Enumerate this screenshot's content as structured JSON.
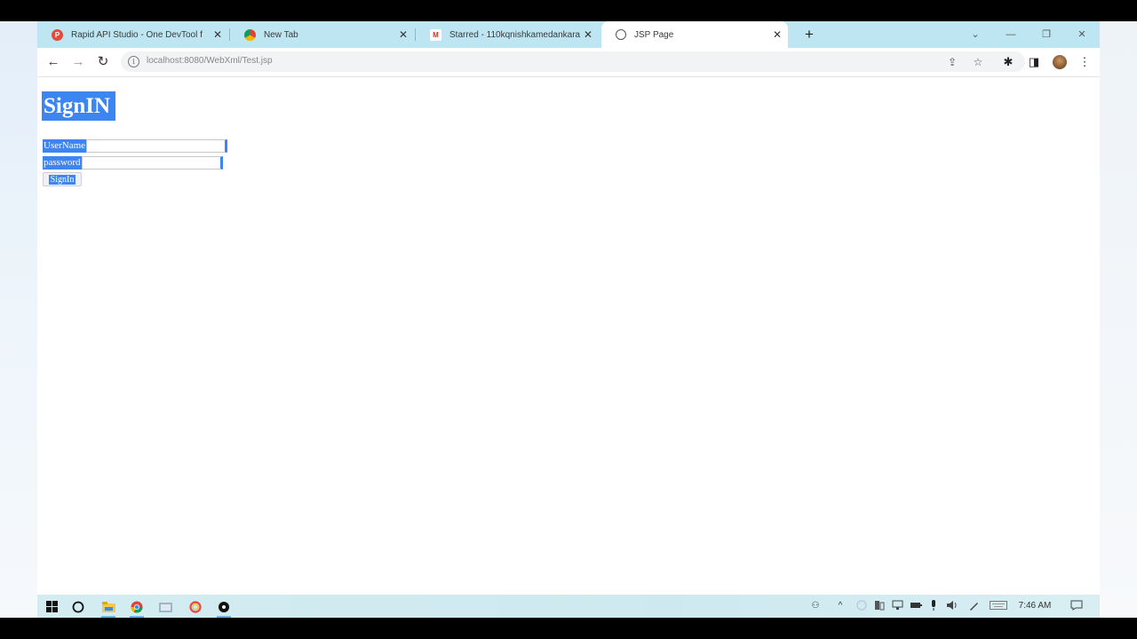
{
  "browser": {
    "tabs": [
      {
        "title": "Rapid API Studio - One DevTool f",
        "favicon": "rapidapi-icon",
        "favicon_letter": "P",
        "favicon_color": "#e14d3a",
        "active": false
      },
      {
        "title": "New Tab",
        "favicon": "chrome-icon",
        "active": false
      },
      {
        "title": "Starred - 110kqnishkamedankara",
        "favicon": "gmail-icon",
        "favicon_letter": "M",
        "active": false
      },
      {
        "title": "JSP Page",
        "favicon": "globe-icon",
        "active": true
      }
    ],
    "tab_close_glyph": "✕",
    "new_tab_glyph": "+",
    "window_controls": {
      "tab_search": "⌄",
      "minimize": "—",
      "restore": "❐",
      "close": "✕"
    },
    "nav": {
      "back": "←",
      "forward": "→",
      "reload": "↻"
    },
    "address": {
      "url": "localhost:8080/WebXml/Test.jsp",
      "info_glyph": "i"
    },
    "omnibox_icons": {
      "share": "⇪",
      "bookmark": "☆"
    },
    "toolbar_icons": {
      "extensions": "✱",
      "side_panel": "◨",
      "menu": "⋮"
    },
    "colors": {
      "tabstrip": "#bde6f2",
      "selection": "#3d85f0"
    }
  },
  "page": {
    "heading": "SignIN",
    "username_label": "UserName",
    "password_label": "password",
    "submit_label": "SignIn",
    "username_value": "",
    "password_value": ""
  },
  "taskbar": {
    "start_icon": "windows-start-icon",
    "pinned": [
      "search-circle-icon",
      "file-explorer-icon",
      "chrome-icon",
      "app-icon",
      "opera-icon",
      "dark-app-icon"
    ],
    "tray": {
      "people": "⚇",
      "chevron": "^",
      "clock": "7:46 AM"
    }
  }
}
